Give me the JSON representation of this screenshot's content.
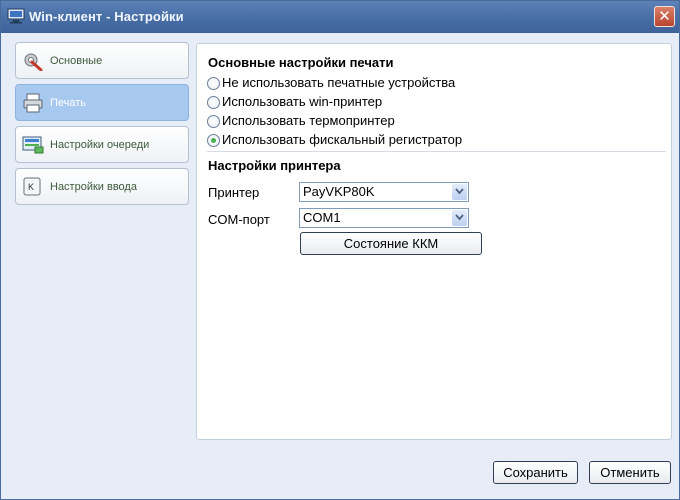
{
  "window": {
    "title": "Win-клиент - Настройки",
    "close_label": "✕"
  },
  "sidebar": {
    "items": [
      {
        "label": "Основные",
        "icon": "gear-wrench-icon",
        "active": false
      },
      {
        "label": "Печать",
        "icon": "printer-icon",
        "active": true
      },
      {
        "label": "Настройки очереди",
        "icon": "queue-monitor-icon",
        "active": false
      },
      {
        "label": "Настройки ввода",
        "icon": "keyboard-key-icon",
        "active": false
      }
    ]
  },
  "print": {
    "heading": "Основные настройки печати",
    "options": [
      {
        "label": "Не использовать печатные устройства",
        "checked": false
      },
      {
        "label": "Использовать win-принтер",
        "checked": false
      },
      {
        "label": "Использовать термопринтер",
        "checked": false
      },
      {
        "label": "Использовать фискальный регистратор",
        "checked": true
      }
    ]
  },
  "printer_settings": {
    "heading": "Настройки принтера",
    "printer_label": "Принтер",
    "printer_value": "PayVKP80K",
    "port_label": "COM-порт",
    "port_value": "COM1",
    "kkm_button": "Состояние ККМ"
  },
  "footer": {
    "save_label": "Сохранить",
    "cancel_label": "Отменить"
  },
  "colors": {
    "titlebar": "#4a70a8",
    "active_item": "#a7c8ef",
    "background": "#e6edf7",
    "radio_checked": "#4cae4c"
  }
}
